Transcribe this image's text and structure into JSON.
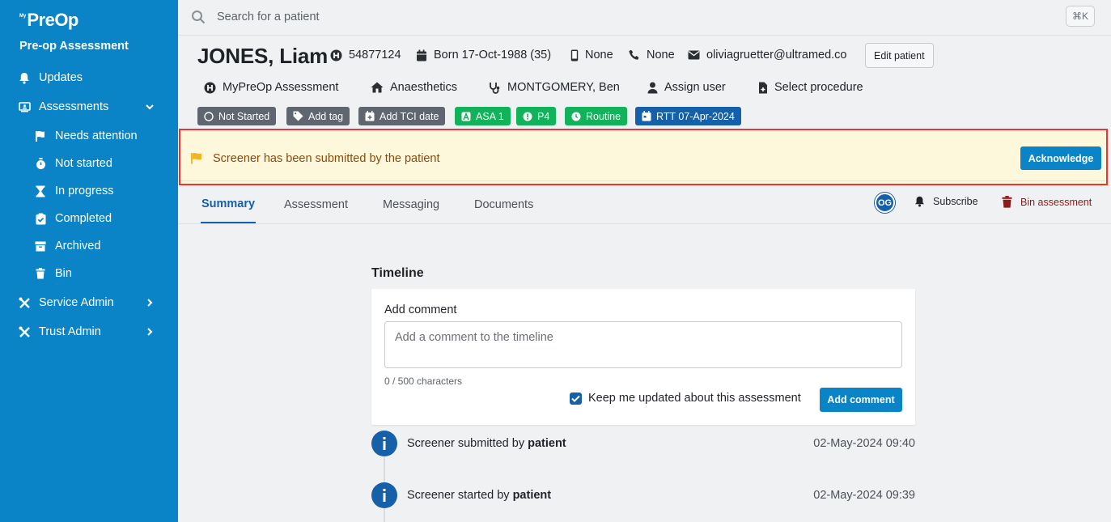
{
  "sidebar": {
    "logo_prefix": "My",
    "logo_main": "PreOp",
    "app_name": "Pre-op Assessment",
    "items": [
      {
        "label": "Updates",
        "icon": "bell-icon"
      },
      {
        "label": "Assessments",
        "icon": "monitor-user-icon",
        "expanded": true
      },
      {
        "label": "Needs attention",
        "icon": "flag-icon"
      },
      {
        "label": "Not started",
        "icon": "stopwatch-icon"
      },
      {
        "label": "In progress",
        "icon": "hourglass-icon"
      },
      {
        "label": "Completed",
        "icon": "clipboard-check-icon"
      },
      {
        "label": "Archived",
        "icon": "archive-box-icon"
      },
      {
        "label": "Bin",
        "icon": "trash-icon"
      },
      {
        "label": "Service Admin",
        "icon": "tools-icon"
      },
      {
        "label": "Trust Admin",
        "icon": "tools-icon"
      }
    ]
  },
  "search": {
    "placeholder": "Search for a patient",
    "shortcut": "⌘K"
  },
  "patient": {
    "name": "JONES, Liam",
    "hospital_number": "54877124",
    "born": "Born 17-Oct-1988 (35)",
    "mobile": "None",
    "phone": "None",
    "email": "oliviagruetter@ultramed.co",
    "edit_label": "Edit patient",
    "assessment_type": "MyPreOp Assessment",
    "specialty": "Anaesthetics",
    "clinician": "MONTGOMERY, Ben",
    "assign_user": "Assign user",
    "select_procedure": "Select procedure"
  },
  "tags": [
    {
      "label": "Not Started",
      "style": "gray"
    },
    {
      "label": "Add tag",
      "style": "gray"
    },
    {
      "label": "Add TCI date",
      "style": "gray"
    },
    {
      "label": "ASA 1",
      "style": "green"
    },
    {
      "label": "P4",
      "style": "green"
    },
    {
      "label": "Routine",
      "style": "green"
    },
    {
      "label": "RTT 07-Apr-2024",
      "style": "blue"
    }
  ],
  "alert": {
    "message": "Screener has been submitted by the patient",
    "action": "Acknowledge"
  },
  "tabs": [
    {
      "label": "Summary",
      "active": true
    },
    {
      "label": "Assessment",
      "active": false
    },
    {
      "label": "Messaging",
      "active": false
    },
    {
      "label": "Documents",
      "active": false
    }
  ],
  "tab_actions": {
    "avatar_initials": "OG",
    "subscribe": "Subscribe",
    "bin": "Bin assessment"
  },
  "timeline": {
    "title": "Timeline",
    "add_comment_label": "Add comment",
    "comment_placeholder": "Add a comment to the timeline",
    "char_count": "0 / 500 characters",
    "keep_updated_label": "Keep me updated about this assessment",
    "keep_updated_checked": true,
    "add_comment_button": "Add comment",
    "events": [
      {
        "text": "Screener submitted by ",
        "actor": "patient",
        "time": "02-May-2024 09:40"
      },
      {
        "text": "Screener started by ",
        "actor": "patient",
        "time": "02-May-2024 09:39"
      }
    ]
  },
  "colors": {
    "sidebar": "#0a84c6",
    "primary_button": "#0a84c6",
    "active_tab": "#1560a8",
    "tag_gray": "#5f6670",
    "tag_green": "#12b25a",
    "tag_blue": "#1560a8",
    "alert_bg": "#fdf8dc",
    "alert_text": "#8a4a0b",
    "bin_text": "#8b1a1a"
  }
}
